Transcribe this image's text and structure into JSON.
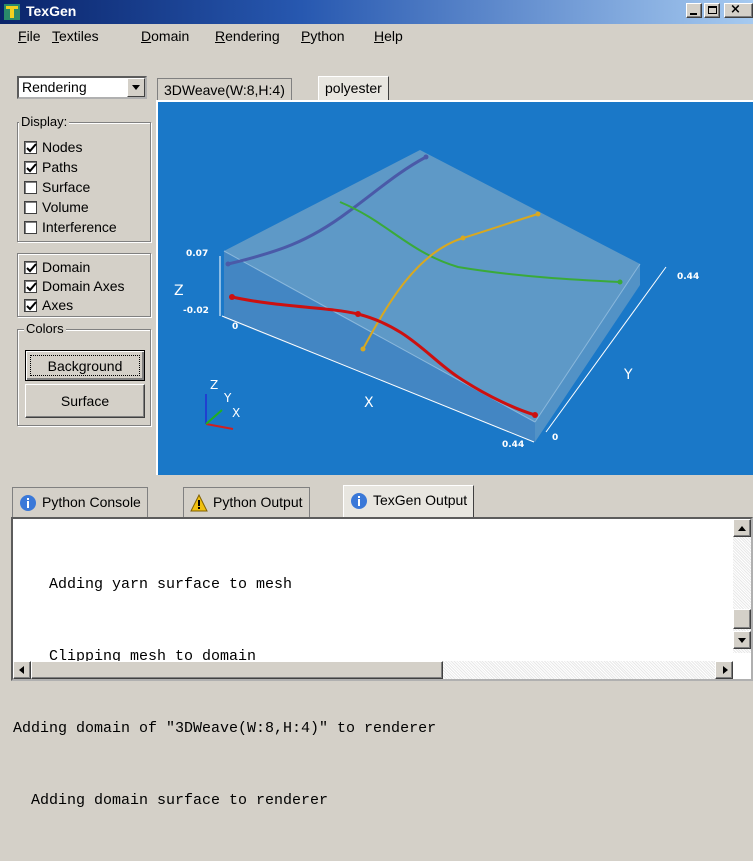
{
  "window": {
    "title": "TexGen"
  },
  "menu": [
    {
      "first": "F",
      "rest": "ile"
    },
    {
      "first": "T",
      "rest": "extiles"
    },
    {
      "first": "D",
      "rest": "omain"
    },
    {
      "first": "R",
      "rest": "endering"
    },
    {
      "first": "P",
      "rest": "ython"
    },
    {
      "first": "H",
      "rest": "elp"
    }
  ],
  "mode_select": {
    "value": "Rendering"
  },
  "tabs": [
    "3DWeave(W:8,H:4)",
    "polyester"
  ],
  "display_group": {
    "title": "Display:",
    "items": [
      {
        "label": "Nodes",
        "checked": true
      },
      {
        "label": "Paths",
        "checked": true
      },
      {
        "label": "Surface",
        "checked": false
      },
      {
        "label": "Volume",
        "checked": false
      },
      {
        "label": "Interference",
        "checked": false
      }
    ]
  },
  "domain_group": {
    "items": [
      {
        "label": "Domain",
        "checked": true
      },
      {
        "label": "Domain Axes",
        "checked": true
      },
      {
        "label": "Axes",
        "checked": true
      }
    ]
  },
  "colors_group": {
    "title": "Colors",
    "background_button": "Background",
    "surface_button": "Surface"
  },
  "viewport": {
    "axis_labels": {
      "x": "X",
      "y": "Y",
      "z": "Z"
    },
    "ticks": {
      "z_top": "0.07",
      "z_bottom": "-0.02",
      "origin": "0",
      "x_end": "0.44",
      "y_end": "0.44",
      "y_start": "0"
    },
    "triad": {
      "x": "X",
      "y": "Y",
      "z": "Z"
    },
    "colors": {
      "background": "#1a78c8",
      "domain_top": "#6b9fc7",
      "yarn_blue": "#4a5aa8",
      "yarn_green": "#3aaa3a",
      "yarn_yellow": "#d8a820",
      "yarn_red": "#cc1010"
    }
  },
  "bottom_tabs": [
    "Python Console",
    "Python Output",
    "TexGen Output"
  ],
  "console": {
    "lines": [
      "    Adding yarn surface to mesh",
      "    Clipping mesh to domain",
      "Adding domain of \"3DWeave(W:8,H:4)\" to renderer",
      "  Adding domain surface to renderer"
    ]
  }
}
